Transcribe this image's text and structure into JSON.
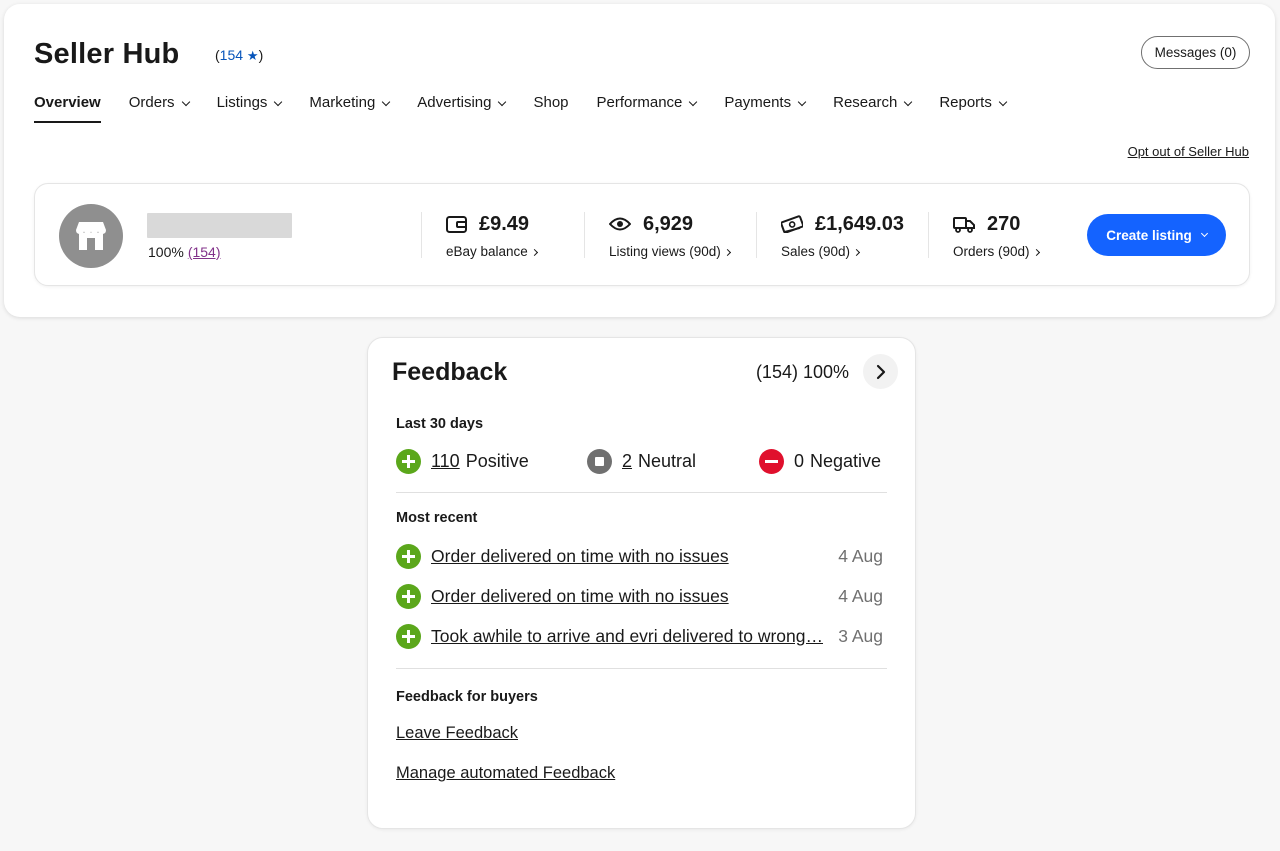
{
  "header": {
    "title": "Seller Hub",
    "rating_open": "(",
    "rating_count": "154",
    "rating_star": "★",
    "rating_close": ")",
    "messages_label": "Messages (0)"
  },
  "nav": {
    "items": [
      {
        "label": "Overview",
        "active": true,
        "dropdown": false
      },
      {
        "label": "Orders",
        "dropdown": true
      },
      {
        "label": "Listings",
        "dropdown": true
      },
      {
        "label": "Marketing",
        "dropdown": true
      },
      {
        "label": "Advertising",
        "dropdown": true
      },
      {
        "label": "Shop",
        "dropdown": false
      },
      {
        "label": "Performance",
        "dropdown": true
      },
      {
        "label": "Payments",
        "dropdown": true
      },
      {
        "label": "Research",
        "dropdown": true
      },
      {
        "label": "Reports",
        "dropdown": true
      }
    ],
    "opt_out": "Opt out of Seller Hub"
  },
  "profile": {
    "score": "100%",
    "feedback_count": "(154)"
  },
  "stats": [
    {
      "icon": "wallet-icon",
      "value": "£9.49",
      "label": "eBay balance"
    },
    {
      "icon": "eye-icon",
      "value": "6,929",
      "label": "Listing views (90d)"
    },
    {
      "icon": "money-icon",
      "value": "£1,649.03",
      "label": "Sales (90d)"
    },
    {
      "icon": "truck-icon",
      "value": "270",
      "label": "Orders (90d)"
    }
  ],
  "create_listing_label": "Create listing",
  "feedback": {
    "title": "Feedback",
    "summary": "(154) 100%",
    "last30_heading": "Last 30 days",
    "positive_count": "110",
    "positive_label": "Positive",
    "neutral_count": "2",
    "neutral_label": "Neutral",
    "negative_count": "0",
    "negative_label": "Negative",
    "recent_heading": "Most recent",
    "recent": [
      {
        "text": "Order delivered on time with no issues",
        "date": "4 Aug"
      },
      {
        "text": "Order delivered on time with no issues",
        "date": "4 Aug"
      },
      {
        "text": "Took awhile to arrive and evri delivered to wrong…",
        "date": "3 Aug"
      }
    ],
    "buyers_heading": "Feedback for buyers",
    "leave_link": "Leave Feedback",
    "manage_link": "Manage automated Feedback"
  },
  "colors": {
    "positive": "#5ba71b",
    "neutral": "#707070",
    "negative": "#e0102d",
    "primary": "#1463ff",
    "link_blue": "#0654ba",
    "purple": "#82318a"
  }
}
